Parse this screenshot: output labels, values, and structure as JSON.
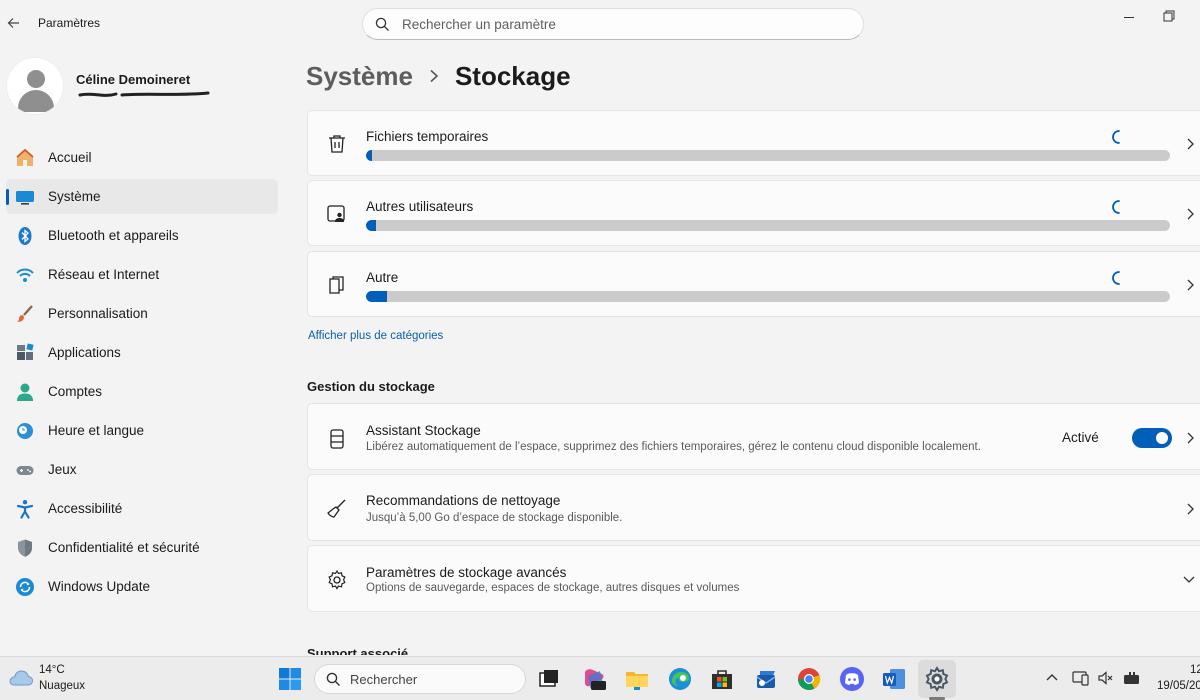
{
  "window": {
    "app_title": "Paramètres",
    "search_placeholder": "Rechercher un paramètre"
  },
  "user": {
    "name": "Céline Demoineret"
  },
  "sidebar": {
    "items": [
      {
        "label": "Accueil",
        "icon": "home-icon",
        "active": false
      },
      {
        "label": "Système",
        "icon": "system-icon",
        "active": true
      },
      {
        "label": "Bluetooth et appareils",
        "icon": "bluetooth-icon",
        "active": false
      },
      {
        "label": "Réseau et Internet",
        "icon": "wifi-icon",
        "active": false
      },
      {
        "label": "Personnalisation",
        "icon": "brush-icon",
        "active": false
      },
      {
        "label": "Applications",
        "icon": "apps-icon",
        "active": false
      },
      {
        "label": "Comptes",
        "icon": "account-icon",
        "active": false
      },
      {
        "label": "Heure et langue",
        "icon": "time-language-icon",
        "active": false
      },
      {
        "label": "Jeux",
        "icon": "gamepad-icon",
        "active": false
      },
      {
        "label": "Accessibilité",
        "icon": "accessibility-icon",
        "active": false
      },
      {
        "label": "Confidentialité et sécurité",
        "icon": "shield-icon",
        "active": false
      },
      {
        "label": "Windows Update",
        "icon": "windows-update-icon",
        "active": false
      }
    ]
  },
  "breadcrumb": {
    "parent": "Système",
    "current": "Stockage"
  },
  "storage_categories": [
    {
      "label": "Fichiers temporaires",
      "icon": "trash-icon",
      "usage_fraction": 0.008
    },
    {
      "label": "Autres utilisateurs",
      "icon": "users-icon",
      "usage_fraction": 0.013
    },
    {
      "label": "Autre",
      "icon": "other-file-icon",
      "usage_fraction": 0.026
    }
  ],
  "show_more_link": "Afficher plus de catégories",
  "management": {
    "section_title": "Gestion du stockage",
    "storage_sense": {
      "title": "Assistant Stockage",
      "desc": "Libérez automatiquement de l’espace, supprimez des fichiers temporaires, gérez le contenu cloud disponible localement.",
      "toggle_label": "Activé",
      "toggle_on": true
    },
    "cleanup": {
      "title": "Recommandations de nettoyage",
      "desc": "Jusqu’à 5,00 Go d’espace de stockage disponible."
    },
    "advanced": {
      "title": "Paramètres de stockage avancés",
      "desc": "Options de sauvegarde, espaces de stockage, autres disques et volumes"
    }
  },
  "next_section_partial": "Support associé",
  "taskbar": {
    "weather_temp": "14°C",
    "weather_desc": "Nuageux",
    "search_placeholder": "Rechercher",
    "clock_time": "12",
    "clock_date": "19/05/20",
    "accent": "#005fb8"
  }
}
